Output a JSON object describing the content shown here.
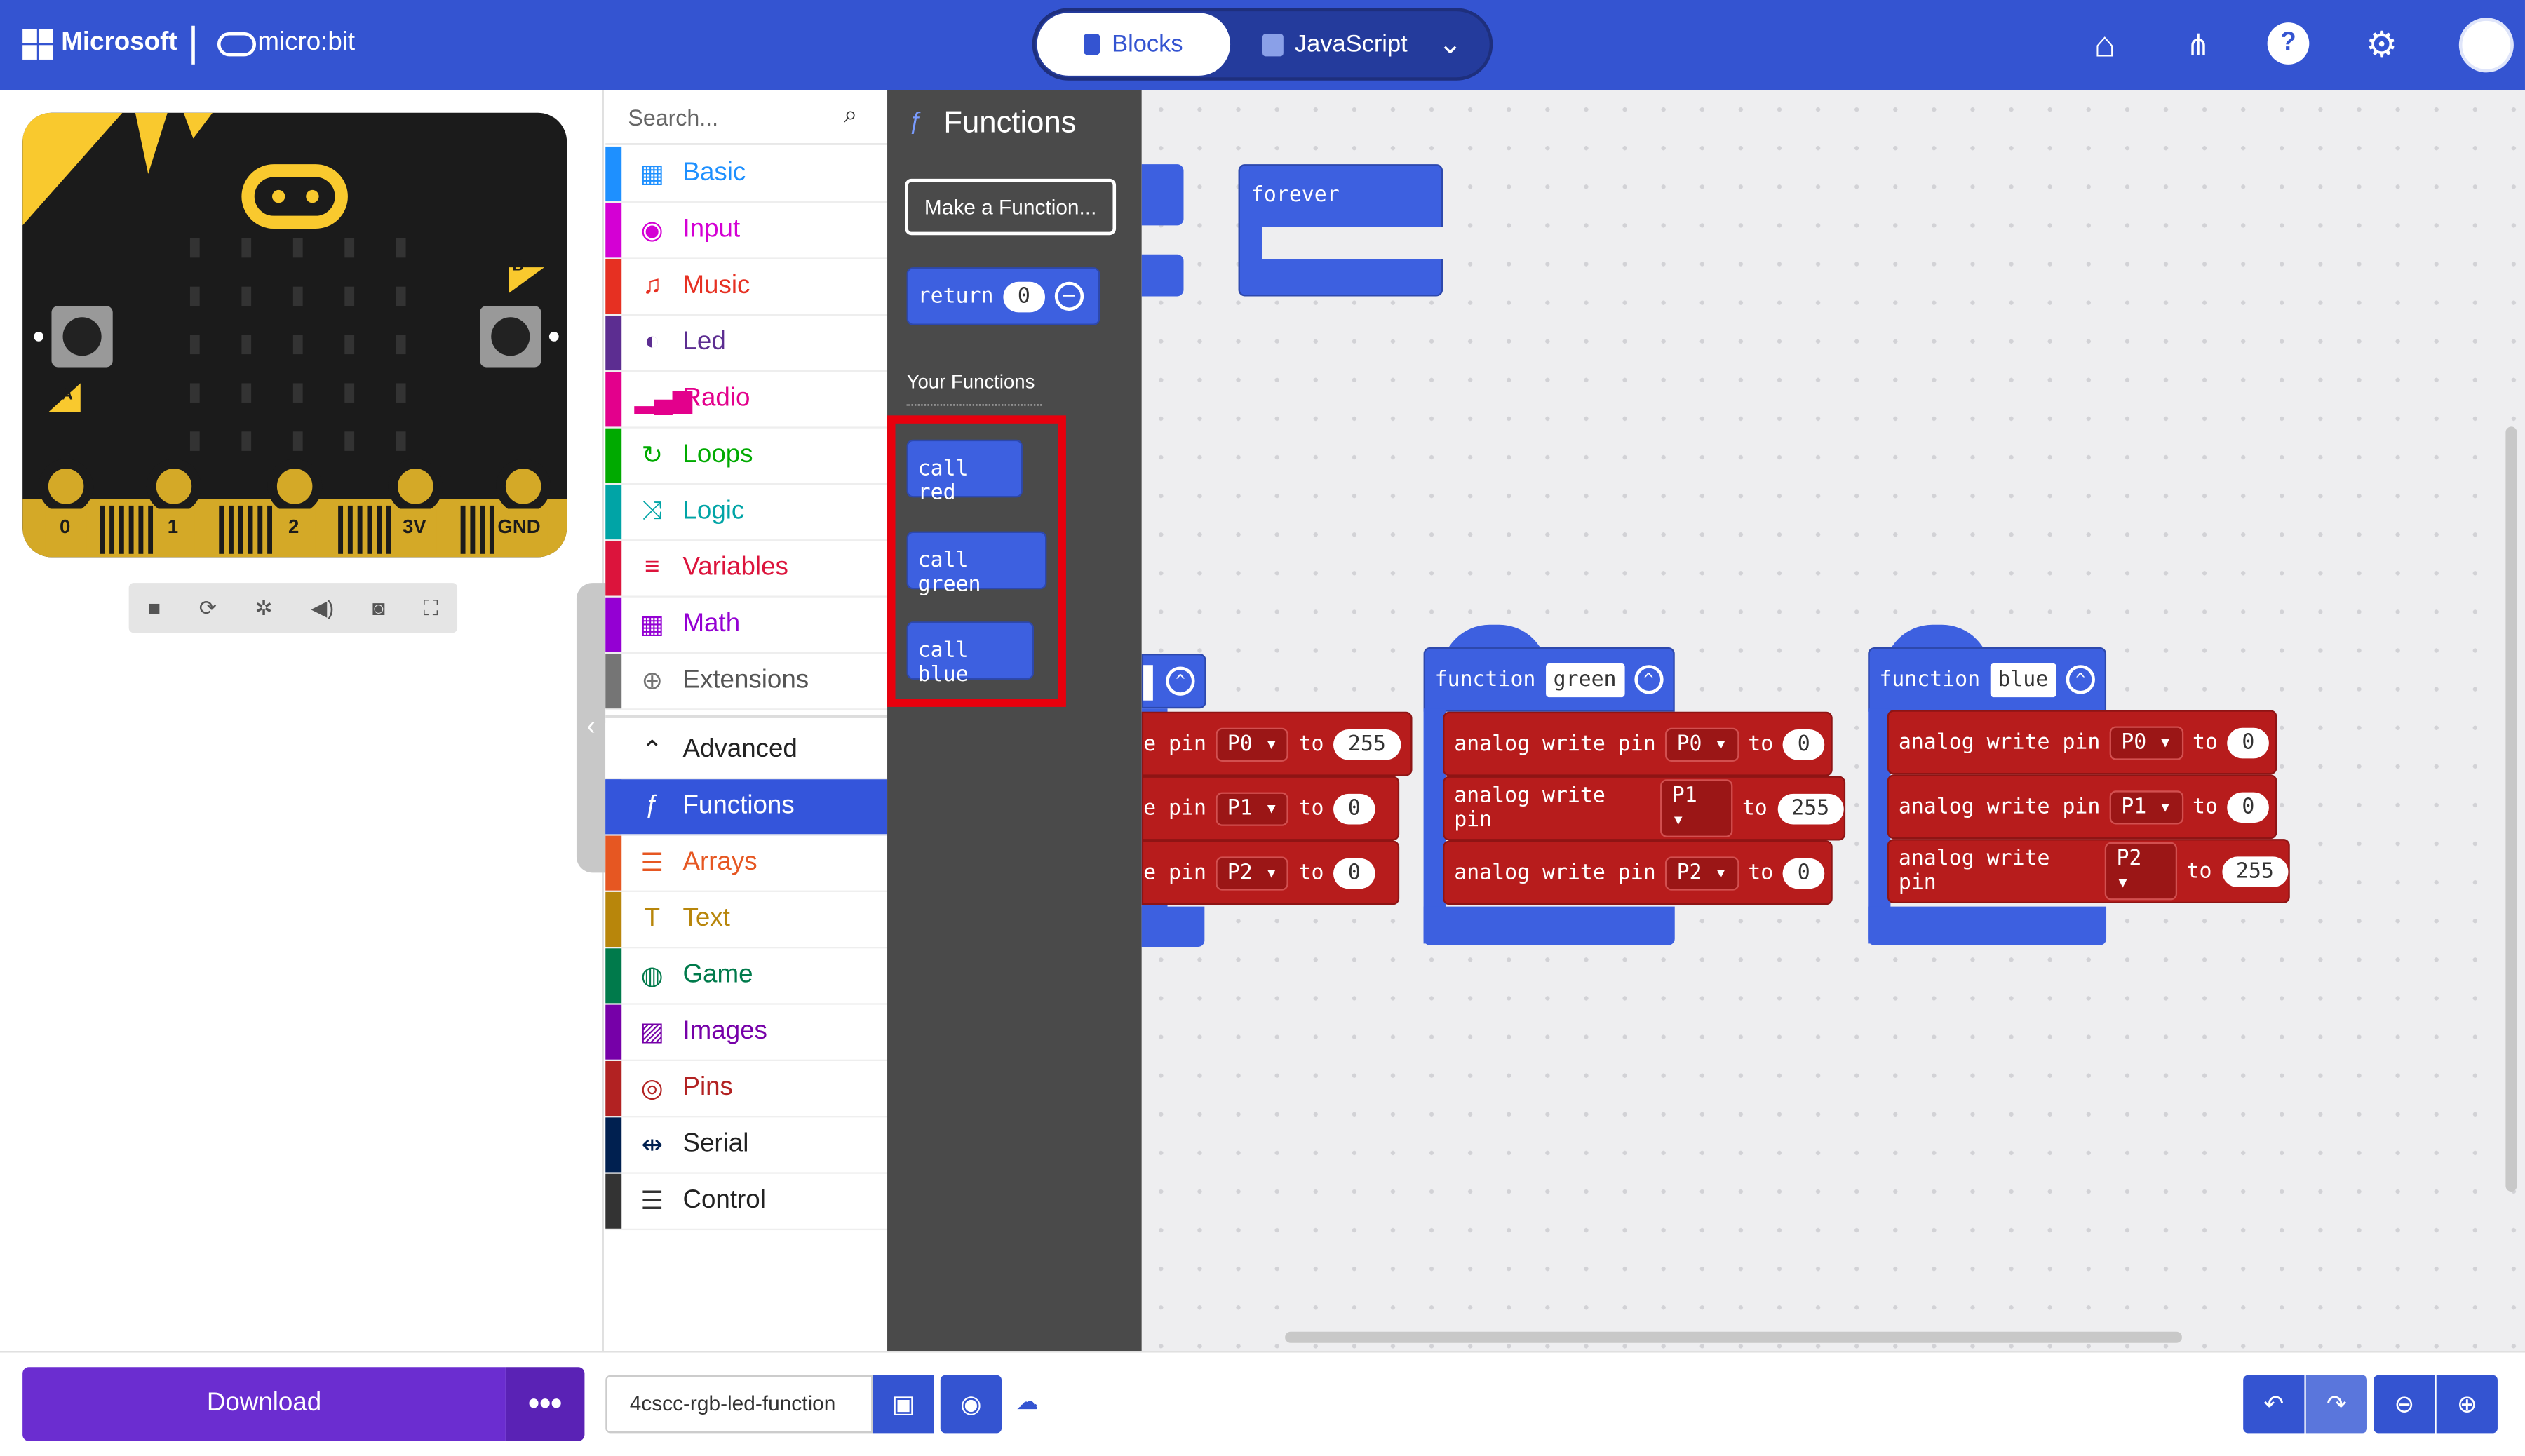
{
  "header": {
    "brand": "Microsoft",
    "product": "micro:bit",
    "tabs": {
      "blocks": "Blocks",
      "javascript": "JavaScript"
    }
  },
  "simulator": {
    "pins": [
      "0",
      "1",
      "2",
      "3V",
      "GND"
    ],
    "button_a": "A",
    "button_b": "B"
  },
  "toolbox": {
    "search_placeholder": "Search...",
    "categories": [
      {
        "label": "Basic",
        "color": "#1e90ff",
        "icon": "grid-icon"
      },
      {
        "label": "Input",
        "color": "#d400d4",
        "icon": "input-icon"
      },
      {
        "label": "Music",
        "color": "#e63022",
        "icon": "headphones-icon"
      },
      {
        "label": "Led",
        "color": "#5c2d91",
        "icon": "toggle-icon"
      },
      {
        "label": "Radio",
        "color": "#e3008c",
        "icon": "signal-icon"
      },
      {
        "label": "Loops",
        "color": "#00aa00",
        "icon": "loop-icon"
      },
      {
        "label": "Logic",
        "color": "#00a4a6",
        "icon": "shuffle-icon"
      },
      {
        "label": "Variables",
        "color": "#dc143c",
        "icon": "list-icon"
      },
      {
        "label": "Math",
        "color": "#9400d3",
        "icon": "calculator-icon"
      },
      {
        "label": "Extensions",
        "color": "#757575",
        "icon": "plus-icon"
      },
      {
        "label": "Advanced",
        "color": "#222222",
        "icon": "chevron-up-icon"
      },
      {
        "label": "Functions",
        "color": "#3455db",
        "icon": "function-icon"
      },
      {
        "label": "Arrays",
        "color": "#e65722",
        "icon": "array-icon"
      },
      {
        "label": "Text",
        "color": "#b8860b",
        "icon": "text-icon"
      },
      {
        "label": "Game",
        "color": "#007a4b",
        "icon": "gamepad-icon"
      },
      {
        "label": "Images",
        "color": "#7600a8",
        "icon": "image-icon"
      },
      {
        "label": "Pins",
        "color": "#b22222",
        "icon": "target-icon"
      },
      {
        "label": "Serial",
        "color": "#002050",
        "icon": "usb-icon"
      },
      {
        "label": "Control",
        "color": "#333333",
        "icon": "server-icon"
      }
    ]
  },
  "flyout": {
    "title": "Functions",
    "make_function": "Make a Function...",
    "return_label": "return",
    "return_value": "0",
    "section_label": "Your Functions",
    "calls": [
      "call red",
      "call green",
      "call blue"
    ]
  },
  "workspace": {
    "forever_label": "forever",
    "function_keyword": "function",
    "partial_function": {
      "rows": [
        {
          "text": "e pin",
          "pin": "P0",
          "to": "to",
          "value": "255"
        },
        {
          "text": "e pin",
          "pin": "P1",
          "to": "to",
          "value": "0"
        },
        {
          "text": "e pin",
          "pin": "P2",
          "to": "to",
          "value": "0"
        }
      ]
    },
    "function_green": {
      "name": "green",
      "rows": [
        {
          "text": "analog write pin",
          "pin": "P0",
          "to": "to",
          "value": "0"
        },
        {
          "text": "analog write pin",
          "pin": "P1",
          "to": "to",
          "value": "255"
        },
        {
          "text": "analog write pin",
          "pin": "P2",
          "to": "to",
          "value": "0"
        }
      ]
    },
    "function_blue": {
      "name": "blue",
      "rows": [
        {
          "text": "analog write pin",
          "pin": "P0",
          "to": "to",
          "value": "0"
        },
        {
          "text": "analog write pin",
          "pin": "P1",
          "to": "to",
          "value": "0"
        },
        {
          "text": "analog write pin",
          "pin": "P2",
          "to": "to",
          "value": "255"
        }
      ]
    }
  },
  "bottom": {
    "download_label": "Download",
    "more_label": "•••",
    "project_name": "4cscc-rgb-led-function"
  }
}
